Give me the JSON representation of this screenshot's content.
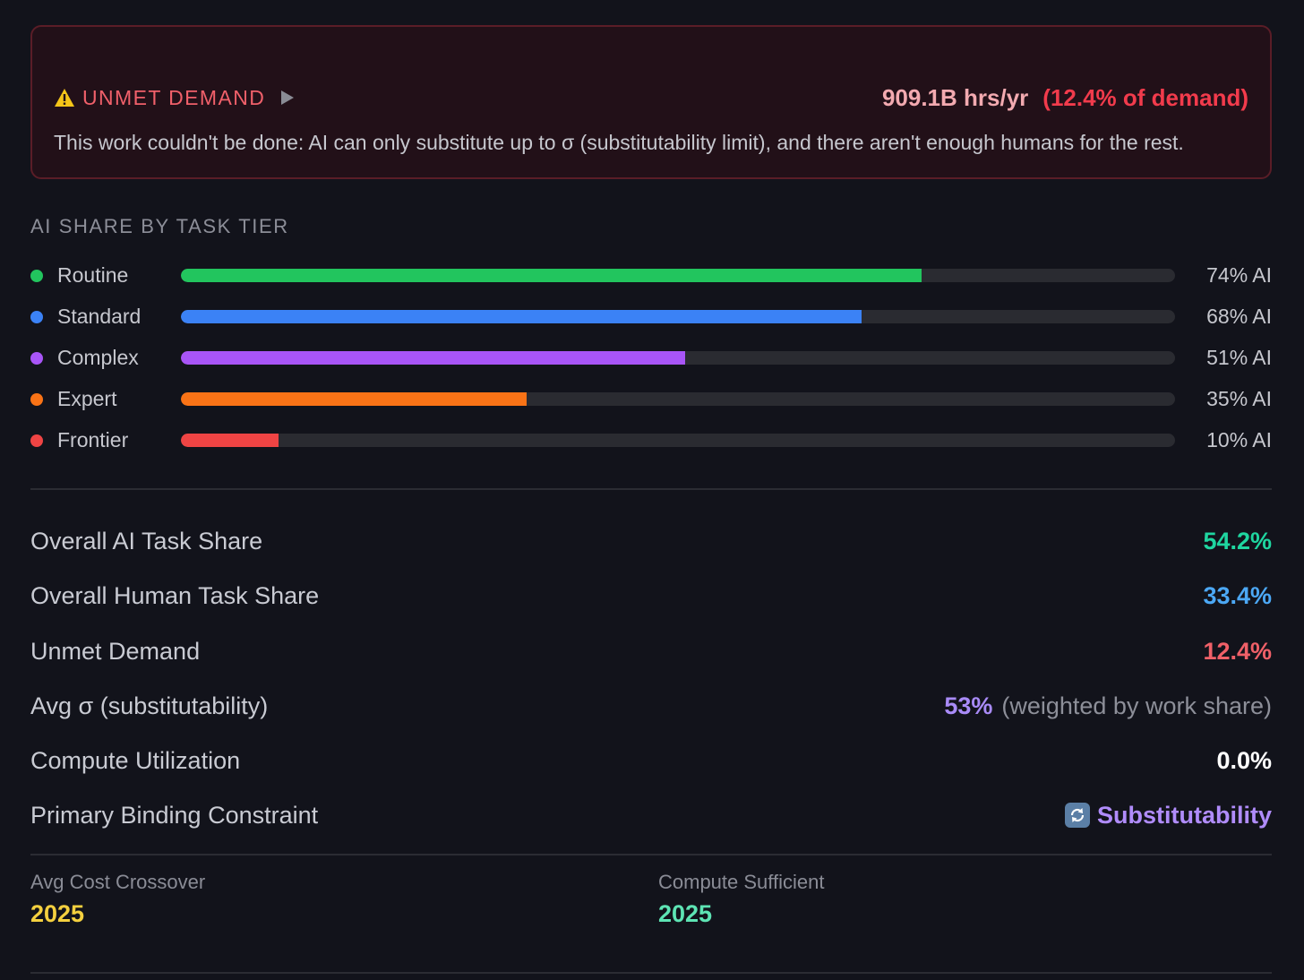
{
  "alert": {
    "title": "UNMET DEMAND",
    "hours": "909.1B hrs/yr",
    "percent": "(12.4% of demand)",
    "description": "This work couldn't be done: AI can only substitute up to σ (substitutability limit), and there aren't enough humans for the rest.",
    "icons": [
      "warning-icon",
      "expand-triangle-icon"
    ]
  },
  "tiers": {
    "title": "AI SHARE BY TASK TIER",
    "items": [
      {
        "label": "Routine",
        "value": "74% AI",
        "share": 0.745,
        "color": "#22c55e"
      },
      {
        "label": "Standard",
        "value": "68% AI",
        "share": 0.685,
        "color": "#3b82f6"
      },
      {
        "label": "Complex",
        "value": "51% AI",
        "share": 0.507,
        "color": "#a855f7"
      },
      {
        "label": "Expert",
        "value": "35% AI",
        "share": 0.348,
        "color": "#f97316"
      },
      {
        "label": "Frontier",
        "value": "10% AI",
        "share": 0.098,
        "color": "#ef4444"
      }
    ]
  },
  "metrics": [
    {
      "label": "Overall AI Task Share",
      "value": "54.2%",
      "color": "#1fd6a0"
    },
    {
      "label": "Overall Human Task Share",
      "value": "33.4%",
      "color": "#4ca8f5"
    },
    {
      "label": "Unmet Demand",
      "value": "12.4%",
      "color": "#f06068"
    },
    {
      "label": "Avg σ (substitutability)",
      "value": "53%",
      "note": "(weighted by work share)",
      "color": "#a98bf8"
    },
    {
      "label": "Compute Utilization",
      "value": "0.0%",
      "color": "#ffffff"
    },
    {
      "label": "Primary Binding Constraint",
      "value": "Substitutability",
      "color": "#b08cfb",
      "icon": "sync-icon"
    }
  ],
  "bottom": {
    "cost_label": "Avg Cost Crossover",
    "cost_value": "2025",
    "cost_color": "#f4d03f",
    "compute_label": "Compute Sufficient",
    "compute_value": "2025",
    "compute_color": "#5ee4b4"
  }
}
